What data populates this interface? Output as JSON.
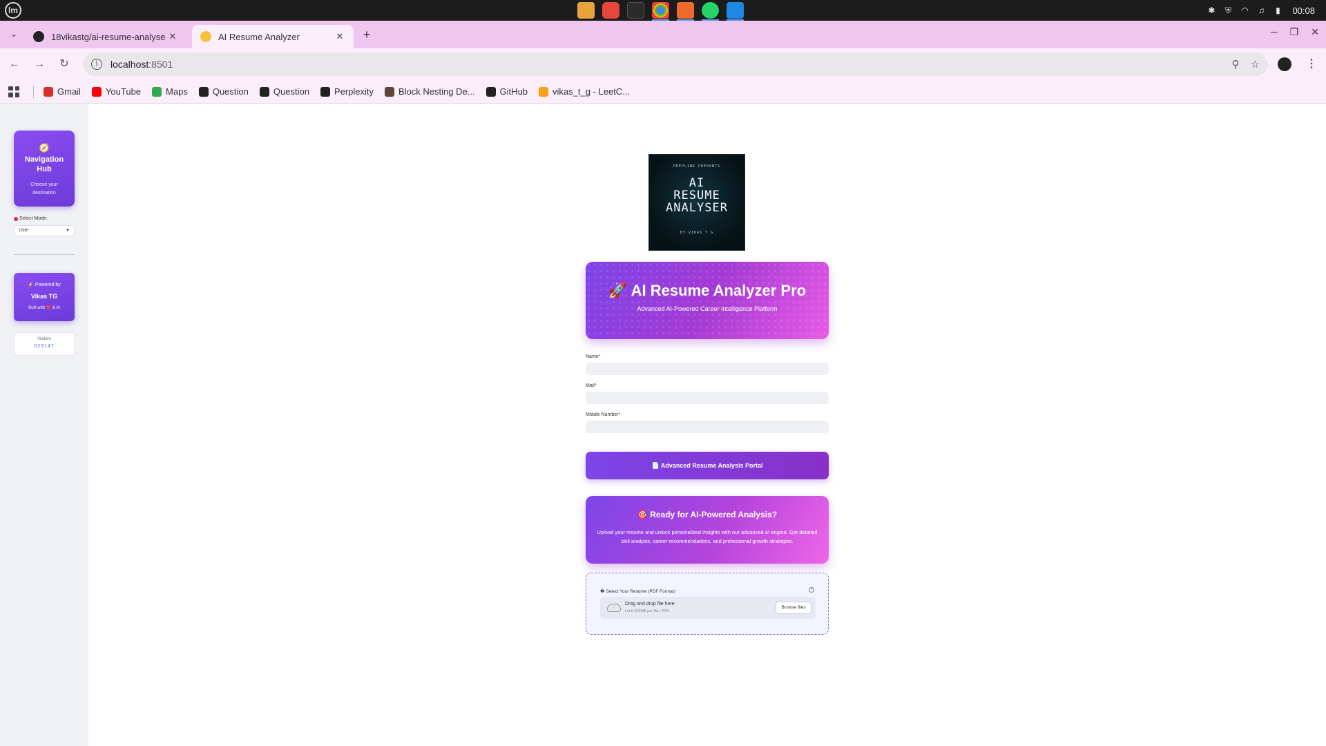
{
  "os": {
    "menu_label": "lm",
    "clock": "00:08"
  },
  "browser": {
    "tabs": [
      {
        "title": "18vikastg/ai-resume-analyse",
        "active": false
      },
      {
        "title": "AI Resume Analyzer",
        "active": true
      }
    ],
    "url_host": "localhost",
    "url_port": ":8501",
    "bookmarks": [
      {
        "label": "Gmail",
        "icon": "gmail-icon",
        "color": "#d93025"
      },
      {
        "label": "YouTube",
        "icon": "youtube-icon",
        "color": "#ff0000"
      },
      {
        "label": "Maps",
        "icon": "maps-icon",
        "color": "#34a853"
      },
      {
        "label": "Question",
        "icon": "globe-icon",
        "color": "#222222"
      },
      {
        "label": "Question",
        "icon": "globe-icon",
        "color": "#222222"
      },
      {
        "label": "Perplexity",
        "icon": "perplexity-icon",
        "color": "#1f1f1f"
      },
      {
        "label": "Block Nesting De...",
        "icon": "codechef-icon",
        "color": "#5b4638"
      },
      {
        "label": "GitHub",
        "icon": "github-icon",
        "color": "#222222"
      },
      {
        "label": "vikas_t_g - LeetC...",
        "icon": "leetcode-icon",
        "color": "#f89f1b"
      }
    ]
  },
  "sidebar": {
    "hub_icon": "🧭",
    "hub_title": "Navigation Hub",
    "hub_subtitle": "Choose your destination",
    "mode_label": "Select Mode:",
    "mode_value": "User",
    "powered_line": "⚡ Powered by",
    "powered_name": "Vikas TG",
    "built_with": "Built with ❤️ & AI",
    "visitors_label": "Visitors",
    "visitors_count": "029147"
  },
  "main": {
    "logo": {
      "top": "PREPLINK PRESENTS",
      "line1": "AI",
      "line2": "RESUME",
      "line3": "ANALYSER",
      "by": "BY VIKAS T G"
    },
    "hero_title": "🚀 AI Resume Analyzer Pro",
    "hero_subtitle": "Advanced AI-Powered Career Intelligence Platform",
    "fields": {
      "name_label": "Name*",
      "mail_label": "Mail*",
      "mobile_label": "Mobile Number*"
    },
    "portal_button": "📄 Advanced Resume Analysis Portal",
    "ready_title": "🎯 Ready for AI-Powered Analysis?",
    "ready_text": "Upload your resume and unlock personalized insights with our advanced AI engine. Get detailed skill analysis, career recommendations, and professional growth strategies.",
    "upload": {
      "label": "� Select Your Resume (PDF Format)",
      "drop_title": "Drag and drop file here",
      "limit": "Limit 200MB per file • PDF",
      "browse": "Browse files"
    }
  }
}
